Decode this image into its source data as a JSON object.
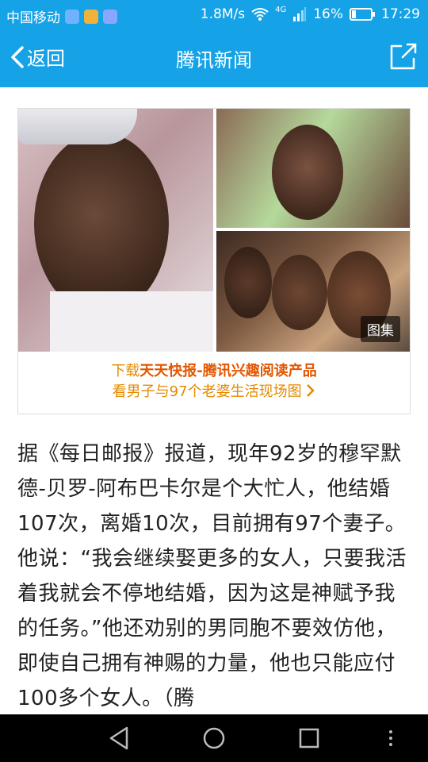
{
  "status_bar": {
    "carrier": "中国移动",
    "speed": "1.8M/s",
    "network": "4G",
    "battery": "16%",
    "time": "17:29"
  },
  "nav": {
    "back_label": "返回",
    "title": "腾讯新闻"
  },
  "media": {
    "gallery_badge": "图集",
    "promo_line1_prefix": "下载",
    "promo_line1_highlight": "天天快报-腾讯兴趣阅读产品",
    "promo_line2": "看男子与97个老婆生活现场图"
  },
  "article": {
    "text": "据《每日邮报》报道，现年92岁的穆罕默德-贝罗-阿布巴卡尔是个大忙人，他结婚107次，离婚10次，目前拥有97个妻子。他说：“我会继续娶更多的女人，只要我活着我就会不停地结婚，因为这是神赋予我的任务。”他还劝别的男同胞不要效仿他，即使自己拥有神赐的力量，他也只能应付100多个女人。（腾"
  },
  "colors": {
    "brand": "#15a2e6",
    "promo_orange": "#e48a00"
  }
}
